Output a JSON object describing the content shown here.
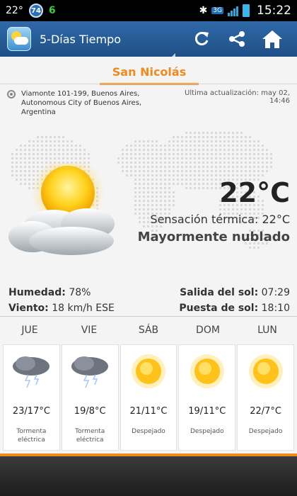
{
  "status_bar": {
    "left_temp": "22°",
    "badge": "74",
    "green_indicator": "6",
    "network": "3G",
    "time": "15:22"
  },
  "app": {
    "title": "5-Días Tiempo",
    "icons": [
      "refresh-icon",
      "share-icon",
      "home-icon"
    ]
  },
  "location": {
    "tab_label": "San Nicolás",
    "address_lines": [
      "Viamonte 101-199, Buenos Aires,",
      "Autonomous City of Buenos Aires,",
      "Argentina"
    ],
    "updated": "Ultima actualización: may 02, 14:46"
  },
  "current": {
    "temperature": "22°C",
    "feels_like": "Sensación térmica: 22°C",
    "condition": "Mayormente nublado",
    "humidity_label": "Humedad:",
    "humidity_value": "78%",
    "wind_label": "Viento:",
    "wind_value": "18 km/h ESE",
    "sunrise_label": "Salida del sol:",
    "sunrise_value": "07:29",
    "sunset_label": "Puesta de sol:",
    "sunset_value": "18:10"
  },
  "forecast": [
    {
      "day": "JUE",
      "range": "23/17°C",
      "desc": "Tormenta eléctrica",
      "icon": "storm-icon"
    },
    {
      "day": "VIE",
      "range": "19/8°C",
      "desc": "Tormenta eléctrica",
      "icon": "storm-icon"
    },
    {
      "day": "SÁB",
      "range": "21/11°C",
      "desc": "Despejado",
      "icon": "sun-icon"
    },
    {
      "day": "DOM",
      "range": "19/11°C",
      "desc": "Despejado",
      "icon": "sun-icon"
    },
    {
      "day": "LUN",
      "range": "22/7°C",
      "desc": "Despejado",
      "icon": "sun-icon"
    }
  ],
  "colors": {
    "accent_orange": "#ef8a1b",
    "actionbar_blue": "#2f6aa8",
    "background": "#f4f4f4"
  }
}
